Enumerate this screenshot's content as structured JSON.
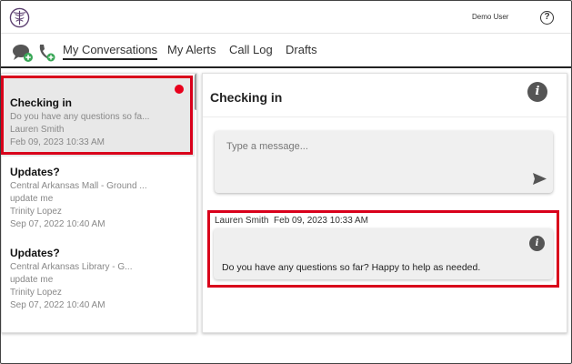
{
  "header": {
    "user_name": "Demo User",
    "help_symbol": "?",
    "logo_icon": "caduceus-logo-icon",
    "help_icon": "question-circle-icon"
  },
  "nav": {
    "icons": [
      "chat-bubbles-add-icon",
      "phone-add-icon"
    ],
    "tabs": [
      {
        "label": "My Conversations",
        "active": true
      },
      {
        "label": "My Alerts",
        "active": false
      },
      {
        "label": "Call Log",
        "active": false
      },
      {
        "label": "Drafts",
        "active": false
      }
    ]
  },
  "conversations": [
    {
      "title": "Checking in",
      "preview": "Do you have any questions so fa...",
      "author": "Lauren Smith",
      "timestamp": "Feb 09, 2023 10:33 AM",
      "unread": true,
      "selected": true
    },
    {
      "title": "Updates?",
      "location": "Central Arkansas Mall - Ground ...",
      "preview": "update me",
      "author": "Trinity Lopez",
      "timestamp": "Sep 07, 2022 10:40 AM",
      "unread": false,
      "selected": false
    },
    {
      "title": "Updates?",
      "location": "Central Arkansas Library - G...",
      "preview": "update me",
      "author": "Trinity Lopez",
      "timestamp": "Sep 07, 2022 10:40 AM",
      "unread": false,
      "selected": false
    }
  ],
  "detail": {
    "title": "Checking in",
    "info_symbol": "i",
    "composer_placeholder": "Type a message...",
    "messages": [
      {
        "author": "Lauren Smith",
        "timestamp": "Feb 09, 2023 10:33 AM",
        "text": "Do you have any questions so far? Happy to help as needed."
      }
    ]
  },
  "colors": {
    "unread_dot": "#e8001c",
    "highlight": "#d9001b",
    "selected_bg": "#e8e8e8",
    "icon_green": "#3aa757"
  }
}
